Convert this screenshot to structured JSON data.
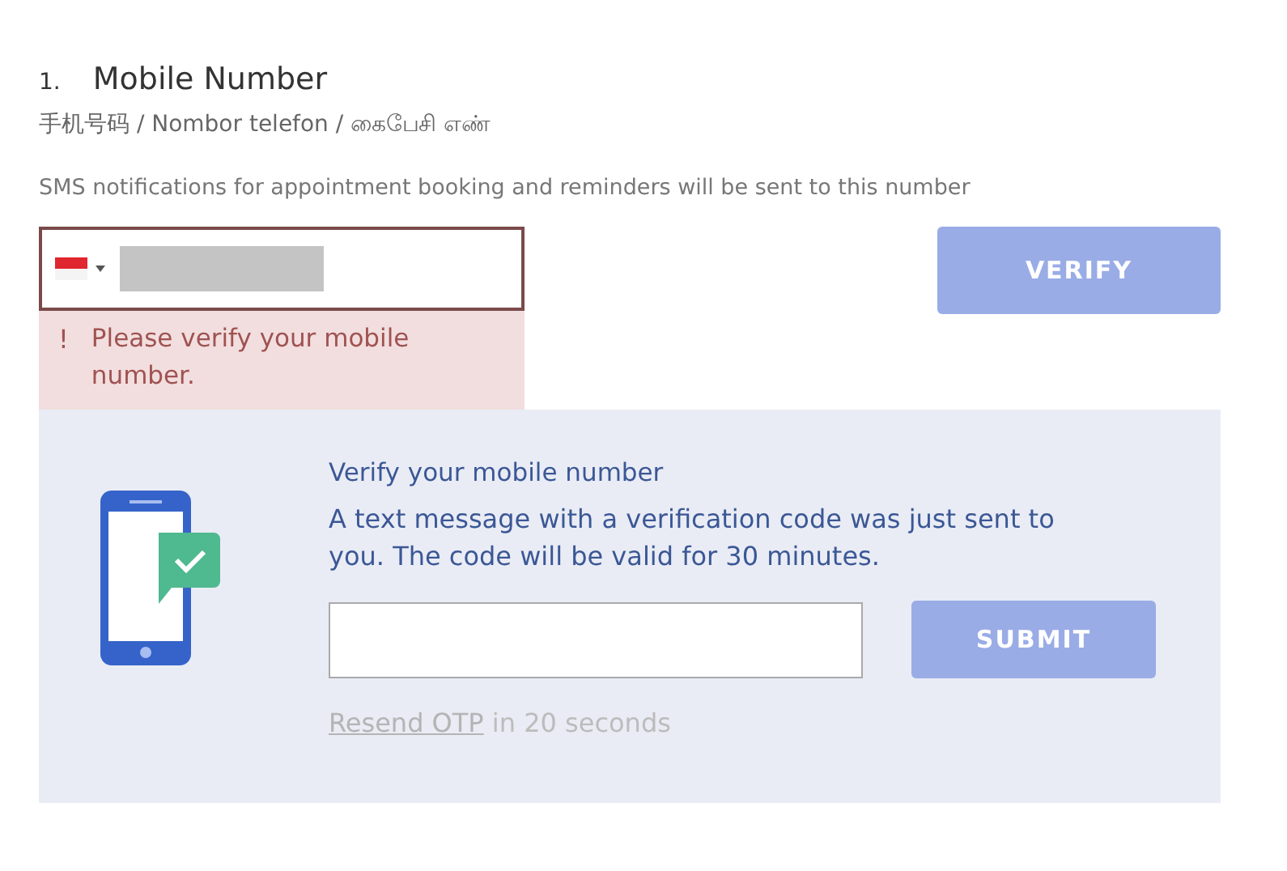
{
  "section": {
    "number": "1.",
    "title": "Mobile Number",
    "subtitle": "手机号码 / Nombor telefon / கைபேசி எண்",
    "hint": "SMS notifications for appointment booking and reminders will be sent to this number"
  },
  "phone_field": {
    "error": true
  },
  "verify_button": {
    "label": "VERIFY",
    "disabled": true
  },
  "error_message": {
    "icon": "!",
    "text": "Please verify your mobile number."
  },
  "otp_panel": {
    "title": "Verify your mobile number",
    "message": "A text message with a verification code was just sent to you. The code will be valid for 30 minutes.",
    "submit_button": {
      "label": "SUBMIT",
      "disabled": true
    },
    "resend": {
      "link": "Resend OTP",
      "rest": "in 20 seconds",
      "disabled": true
    }
  }
}
